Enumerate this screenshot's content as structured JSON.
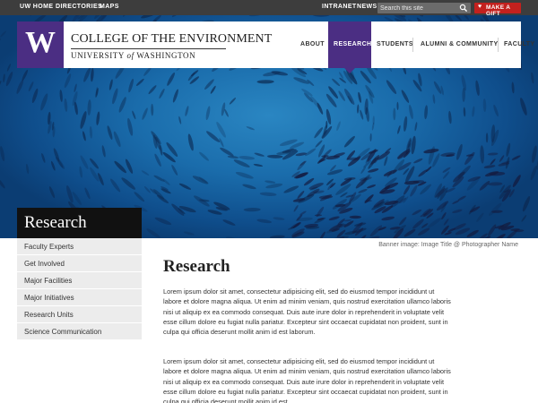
{
  "utility_bar": {
    "links": [
      "UW HOME",
      "DIRECTORIES",
      "MAPS"
    ],
    "intranet": "INTRANET",
    "news": "NEWS",
    "search_placeholder": "Search this site",
    "gift_label": "MAKE A GIFT"
  },
  "header": {
    "logo_letter": "W",
    "college_name": "COLLEGE OF THE ENVIRONMENT",
    "university_pre": "UNIVERSITY",
    "university_of": "of",
    "university_post": "WASHINGTON"
  },
  "nav": {
    "items": [
      {
        "label": "ABOUT",
        "active": false
      },
      {
        "label": "RESEARCH",
        "active": true
      },
      {
        "label": "STUDENTS",
        "active": false
      },
      {
        "label": "ALUMNI & COMMUNITY",
        "active": false
      },
      {
        "label": "FACULTY",
        "active": false
      }
    ]
  },
  "section_title": "Research",
  "sidebar": {
    "items": [
      "Faculty Experts",
      "Get Involved",
      "Major Facilities",
      "Major Initiatives",
      "Research Units",
      "Science Communication"
    ]
  },
  "banner_caption": "Banner image: Image Title @ Photographer Name",
  "content": {
    "title": "Research",
    "paragraphs": [
      "Lorem ipsum dolor sit amet, consectetur adipisicing elit, sed do eiusmod tempor incididunt ut labore et dolore magna aliqua. Ut enim ad minim veniam, quis nostrud exercitation ullamco laboris nisi ut aliquip ex ea commodo consequat. Duis aute irure dolor in reprehenderit in voluptate velit esse cillum dolore eu fugiat nulla pariatur. Excepteur sint occaecat cupidatat non proident, sunt in culpa qui officia deserunt mollit anim id est laborum.",
      "Lorem ipsum dolor sit amet, consectetur adipisicing elit, sed do eiusmod tempor incididunt ut labore et dolore magna aliqua. Ut enim ad minim veniam, quis nostrud exercitation ullamco laboris nisi ut aliquip ex ea commodo consequat. Duis aute irure dolor in reprehenderit in voluptate velit esse cillum dolore eu fugiat nulla pariatur. Excepteur sint occaecat cupidatat non proident, sunt in culpa qui officia deserunt mollit anim id est"
    ]
  },
  "icons": {
    "search": "search-icon",
    "gift": "heart-icon"
  },
  "colors": {
    "uw_purple": "#4b2e83",
    "gift_red": "#c3211e",
    "topbar": "#3d3d3d",
    "sidebar_bg": "#ececec"
  }
}
